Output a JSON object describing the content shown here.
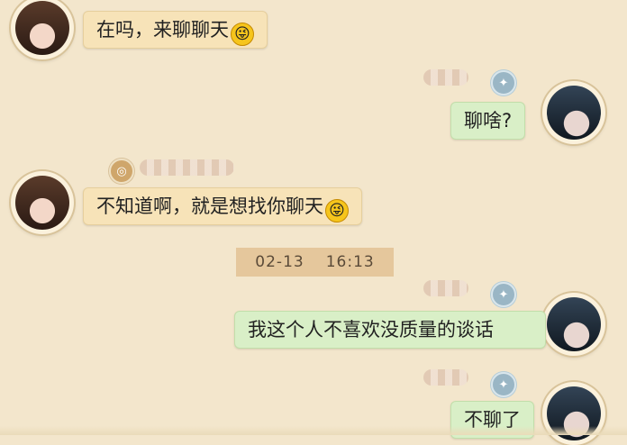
{
  "colors": {
    "background": "#f3e6cc",
    "incoming_bubble": "#f7e3b8",
    "outgoing_bubble": "#d9efc7",
    "timestamp_bg": "#e5c79c"
  },
  "messages": [
    {
      "side": "left",
      "text": "在吗，来聊聊天",
      "emoji": "😜"
    },
    {
      "side": "right",
      "text": "聊啥?"
    },
    {
      "side": "left",
      "text": "不知道啊，就是想找你聊天",
      "emoji": "😜"
    },
    {
      "side": "right",
      "text": "我这个人不喜欢没质量的谈话"
    },
    {
      "side": "right",
      "text": "不聊了"
    }
  ],
  "timestamp": {
    "date": "02-13",
    "time": "16:13"
  },
  "icons": {
    "male_badge": "sword-badge-icon",
    "female_badge": "swirl-badge-icon",
    "emoji": "grinning-tongue-emoji-icon"
  }
}
